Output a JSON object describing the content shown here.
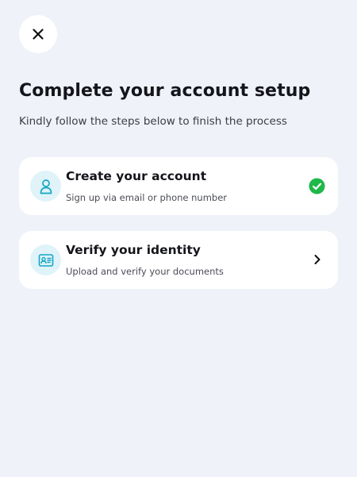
{
  "header": {
    "close_icon": "close-icon",
    "title": "Complete your account setup",
    "subtitle": "Kindly follow the steps below to finish the process"
  },
  "steps": [
    {
      "icon": "user-icon",
      "title": "Create your account",
      "description": "Sign up via email or phone number",
      "status": "completed",
      "status_icon": "check-circle-icon"
    },
    {
      "icon": "id-card-icon",
      "title": "Verify your identity",
      "description": "Upload and verify your documents",
      "status": "pending",
      "status_icon": "chevron-right-icon"
    }
  ],
  "colors": {
    "background": "#eff2f8",
    "card": "#ffffff",
    "icon_bg": "#dff3f8",
    "icon_accent": "#14a6c5",
    "success": "#1fb84a",
    "text": "#14151a"
  }
}
